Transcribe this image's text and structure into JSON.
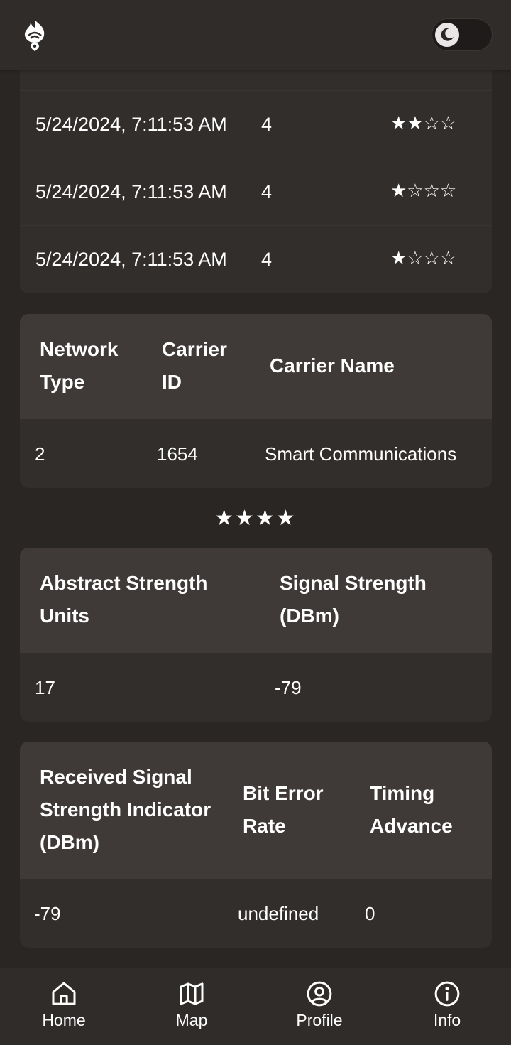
{
  "colors": {
    "background": "#2a2624",
    "card": "#322e2c",
    "card_header": "#3f3937",
    "bar": "#302c2a",
    "text": "#ffffff"
  },
  "header": {
    "logo_icon": "flame-pin-icon",
    "theme_toggle_icon": "moon-icon"
  },
  "log_table": {
    "rows": [
      {
        "date": "5/24/2024, 7:11:53 AM",
        "value": "4",
        "stars": "★★☆☆"
      },
      {
        "date": "5/24/2024, 7:11:53 AM",
        "value": "4",
        "stars": "★☆☆☆"
      },
      {
        "date": "5/24/2024, 7:11:53 AM",
        "value": "4",
        "stars": "★☆☆☆"
      }
    ]
  },
  "network_table": {
    "headers": [
      "Network Type",
      "Carrier ID",
      "Carrier Name"
    ],
    "row": [
      "2",
      "1654",
      "Smart Communications"
    ]
  },
  "rating": {
    "stars": "★★★★",
    "value": 4,
    "max": 4
  },
  "strength_table": {
    "headers": [
      "Abstract Strength Units",
      "Signal Strength (DBm)"
    ],
    "row": [
      "17",
      "-79"
    ]
  },
  "signal_table": {
    "headers": [
      "Received Signal Strength Indicator (DBm)",
      "Bit Error Rate",
      "Timing Advance"
    ],
    "row": [
      "-79",
      "undefined",
      "0"
    ]
  },
  "nav": [
    {
      "label": "Home",
      "icon": "home-icon"
    },
    {
      "label": "Map",
      "icon": "map-icon"
    },
    {
      "label": "Profile",
      "icon": "profile-icon"
    },
    {
      "label": "Info",
      "icon": "info-icon"
    }
  ]
}
